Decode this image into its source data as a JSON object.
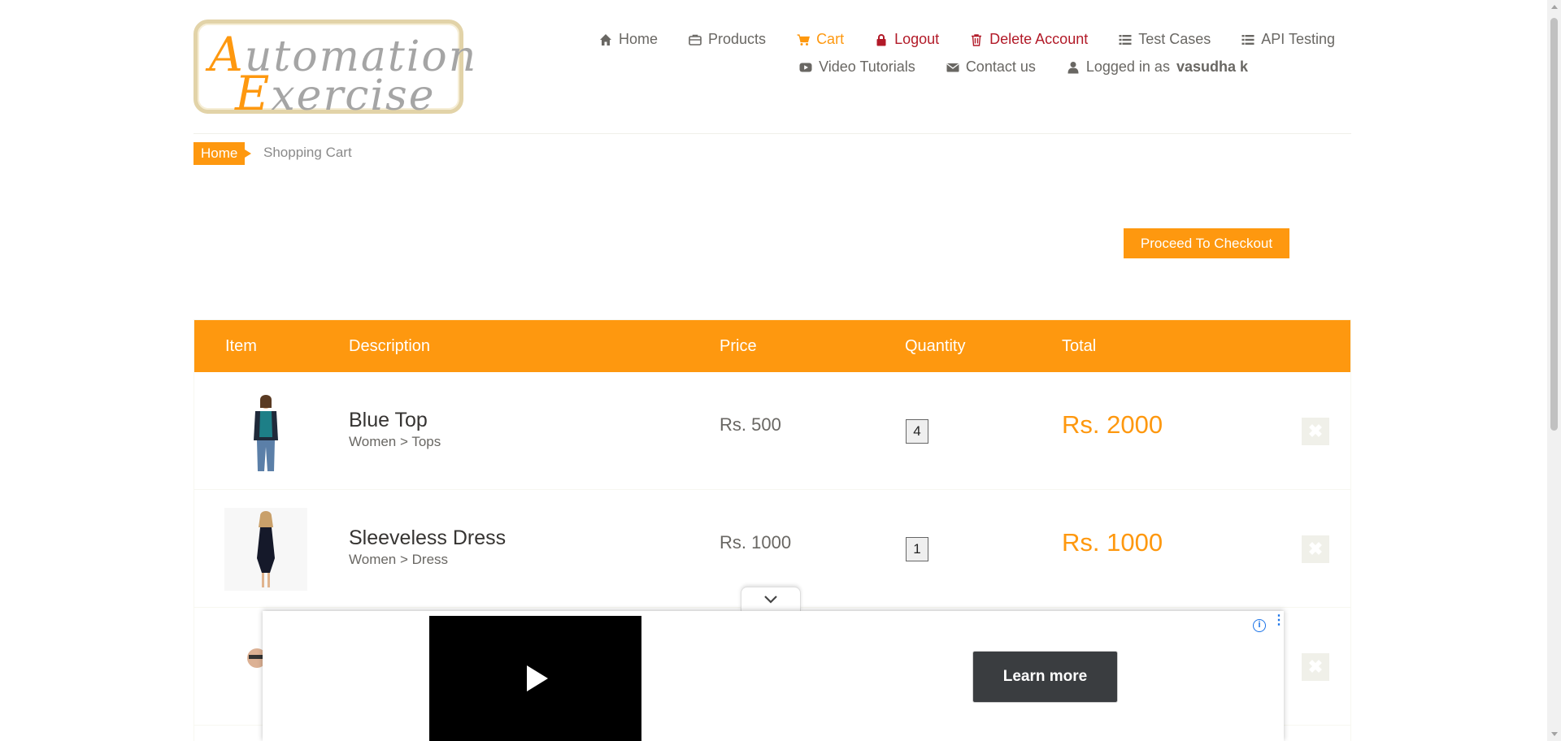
{
  "logo": {
    "line1_cap": "A",
    "line1_rest": "utomation",
    "line2_cap": "E",
    "line2_rest": "xercise"
  },
  "nav": {
    "row1": [
      {
        "label": "Home",
        "icon": "home-icon"
      },
      {
        "label": "Products",
        "icon": "briefcase-icon"
      },
      {
        "label": "Cart",
        "icon": "cart-icon",
        "active": true
      },
      {
        "label": "Logout",
        "icon": "lock-icon"
      },
      {
        "label": "Delete Account",
        "icon": "trash-icon"
      },
      {
        "label": "Test Cases",
        "icon": "list-icon"
      },
      {
        "label": "API Testing",
        "icon": "list-icon"
      }
    ],
    "row2": [
      {
        "label": "Video Tutorials",
        "icon": "youtube-icon"
      },
      {
        "label": "Contact us",
        "icon": "envelope-icon"
      },
      {
        "label_prefix": "Logged in as",
        "username": "vasudha k",
        "icon": "user-icon"
      }
    ]
  },
  "breadcrumb": {
    "home": "Home",
    "current": "Shopping Cart"
  },
  "checkout_button": "Proceed To Checkout",
  "cart": {
    "columns": [
      "Item",
      "Description",
      "Price",
      "Quantity",
      "Total"
    ],
    "rows": [
      {
        "name": "Blue Top",
        "category": "Women > Tops",
        "price": "Rs. 500",
        "quantity": "4",
        "total": "Rs. 2000"
      },
      {
        "name": "Sleeveless Dress",
        "category": "Women > Dress",
        "price": "Rs. 1000",
        "quantity": "1",
        "total": "Rs. 1000"
      },
      {
        "name": "",
        "category": "",
        "price": "",
        "quantity": "",
        "total": ""
      }
    ],
    "delete_glyph": "✖"
  },
  "ad": {
    "learn_more": "Learn more",
    "info_glyph": "i",
    "menu_glyph": "⋮"
  },
  "colors": {
    "accent": "#FE980F",
    "logout_red": "#B21A28",
    "ad_button": "#3A3D40"
  }
}
